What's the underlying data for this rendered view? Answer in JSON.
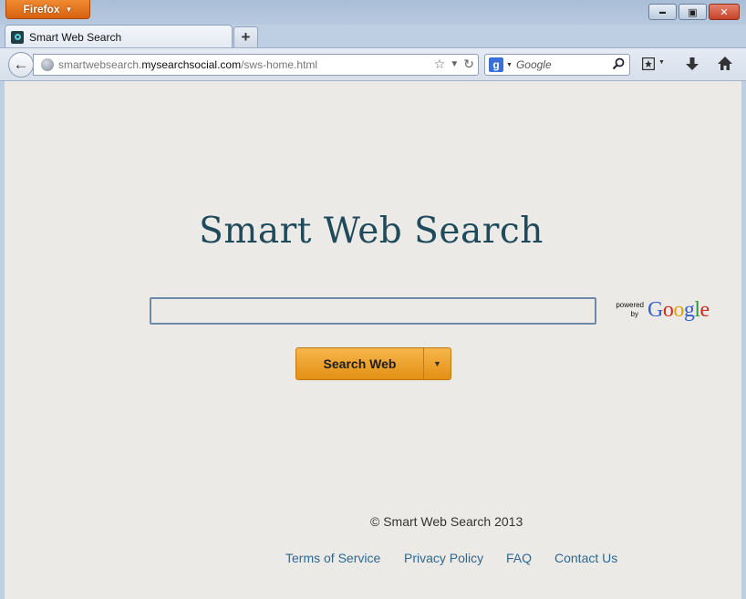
{
  "window": {
    "app_menu_label": "Firefox",
    "minimize_glyph": "▬",
    "restore_glyph": "▣",
    "close_glyph": "✕"
  },
  "tabs": [
    {
      "label": "Smart Web Search",
      "favicon": "search-favicon-icon"
    }
  ],
  "new_tab_glyph": "+",
  "navbar": {
    "back_icon": "←",
    "url_prefix": "smartwebsearch.",
    "url_domain": "mysearchsocial.com",
    "url_path": "/sws-home.html",
    "search_engine_icon": "g",
    "search_placeholder": "Google"
  },
  "page": {
    "title": "Smart Web Search",
    "search_value": "",
    "powered_by_line1": "powered",
    "powered_by_line2": "by",
    "google_letters": [
      "G",
      "o",
      "o",
      "g",
      "l",
      "e"
    ],
    "google_colors": [
      "#3a5fc7",
      "#d12d1e",
      "#e0a50a",
      "#3a5fc7",
      "#2c9a3d",
      "#d12d1e"
    ],
    "search_button_label": "Search Web",
    "copyright": "© Smart Web Search 2013",
    "footer_links": [
      "Terms of Service",
      "Privacy Policy",
      "FAQ",
      "Contact Us"
    ]
  },
  "colors": {
    "accent_orange": "#e8981e",
    "title_teal": "#1e4a5c",
    "link_blue": "#2e6891"
  }
}
